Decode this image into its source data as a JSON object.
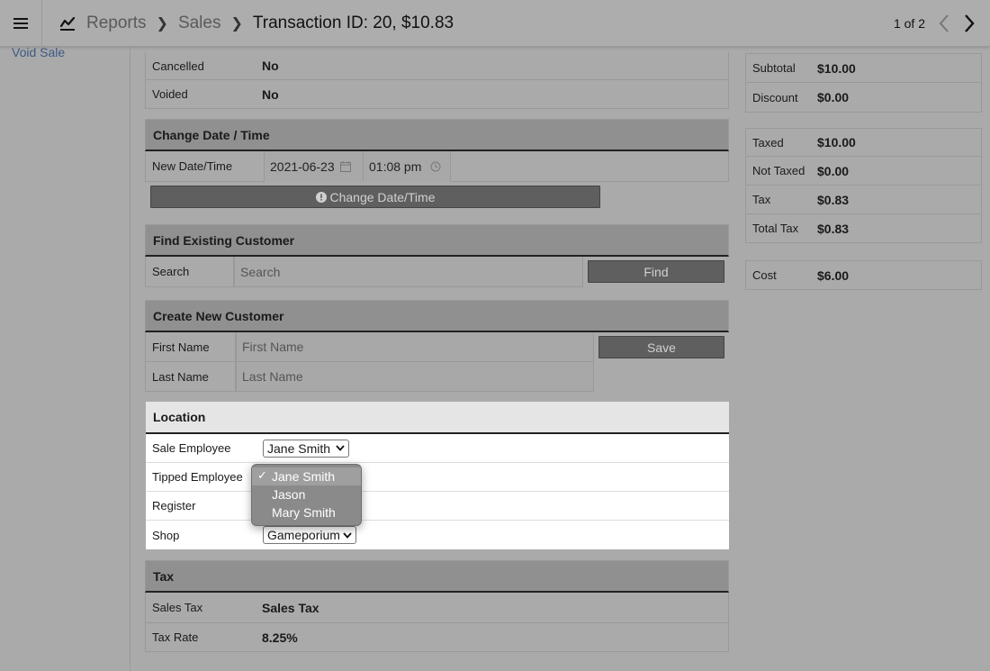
{
  "topbar": {
    "breadcrumbs": [
      "Reports",
      "Sales"
    ],
    "current": "Transaction ID: 20, $10.83",
    "pager": "1 of 2"
  },
  "sidebar": {
    "void_sale": "Void Sale"
  },
  "status": {
    "rows": [
      {
        "label": "Cancelled",
        "value": "No"
      },
      {
        "label": "Voided",
        "value": "No"
      }
    ]
  },
  "change_date": {
    "title": "Change Date / Time",
    "label": "New Date/Time",
    "date": "2021-06-23",
    "time": "01:08 pm",
    "button": "Change Date/Time"
  },
  "find_customer": {
    "title": "Find Existing Customer",
    "label": "Search",
    "placeholder": "Search",
    "button": "Find"
  },
  "create_customer": {
    "title": "Create New Customer",
    "first_label": "First Name",
    "first_placeholder": "First Name",
    "last_label": "Last Name",
    "last_placeholder": "Last Name",
    "button": "Save"
  },
  "location": {
    "title": "Location",
    "sale_employee_label": "Sale Employee",
    "sale_employee_value": "Jane Smith",
    "tipped_employee_label": "Tipped Employee",
    "register_label": "Register",
    "shop_label": "Shop",
    "shop_value": "Gameporium",
    "dropdown_options": [
      "Jane Smith",
      "Jason",
      "Mary Smith"
    ],
    "dropdown_selected": "Jane Smith"
  },
  "tax": {
    "title": "Tax",
    "rows": [
      {
        "label": "Sales Tax",
        "value": "Sales Tax"
      },
      {
        "label": "Tax Rate",
        "value": "8.25%"
      }
    ]
  },
  "summary": {
    "group1": [
      {
        "label": "Subtotal",
        "value": "$10.00"
      },
      {
        "label": "Discount",
        "value": "$0.00"
      }
    ],
    "group2": [
      {
        "label": "Taxed",
        "value": "$10.00"
      },
      {
        "label": "Not Taxed",
        "value": "$0.00"
      },
      {
        "label": "Tax",
        "value": "$0.83"
      },
      {
        "label": "Total Tax",
        "value": "$0.83"
      }
    ],
    "group3": [
      {
        "label": "Cost",
        "value": "$6.00"
      }
    ]
  },
  "colors": {
    "dim_background": "#aaaaaa",
    "link": "#3d5a86",
    "button": "#5f5f5f"
  }
}
